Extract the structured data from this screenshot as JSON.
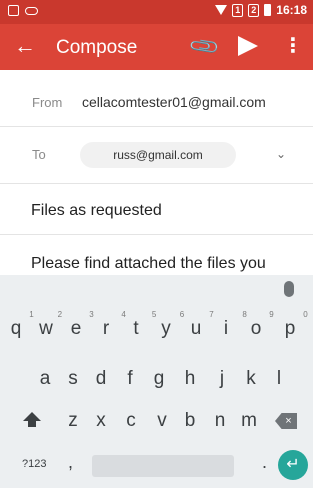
{
  "status_bar": {
    "time": "16:18",
    "sim1": "1",
    "sim2": "2"
  },
  "app_bar": {
    "back_icon": "arrow-back-icon",
    "title": "Compose",
    "attach_icon": "paperclip-icon",
    "send_icon": "send-icon",
    "more_icon": "more-vert-icon",
    "color": "#db4437",
    "status_color": "#c9382d"
  },
  "from": {
    "label": "From",
    "value": "cellacomtester01@gmail.com"
  },
  "to": {
    "label": "To",
    "recipient": "russ@gmail.com",
    "expand_icon": "chevron-down-icon"
  },
  "subject": "Files as requested",
  "body": "Please find attached the files you",
  "keyboard": {
    "row1": [
      "q",
      "w",
      "e",
      "r",
      "t",
      "y",
      "u",
      "i",
      "o",
      "p"
    ],
    "row1_numbers": [
      "1",
      "2",
      "3",
      "4",
      "5",
      "6",
      "7",
      "8",
      "9",
      "0"
    ],
    "row2": [
      "a",
      "s",
      "d",
      "f",
      "g",
      "h",
      "j",
      "k",
      "l"
    ],
    "row3": [
      "z",
      "x",
      "c",
      "v",
      "b",
      "n",
      "m"
    ],
    "symbols_label": "?123",
    "comma": ",",
    "period": ".",
    "enter_color": "#26a69a"
  }
}
